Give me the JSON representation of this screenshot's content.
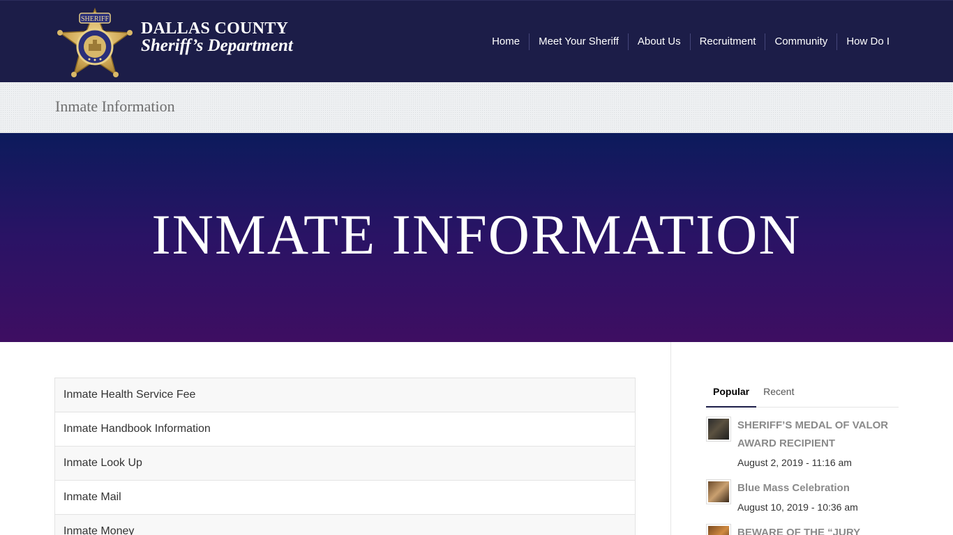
{
  "logo": {
    "line1": "DALLAS COUNTY",
    "line2": "Sheriff’s Department",
    "badge_top": "SHERIFF",
    "badge_ring": "SHERIFF'S DEPARTMENT"
  },
  "nav": [
    {
      "label": "Home"
    },
    {
      "label": "Meet Your Sheriff"
    },
    {
      "label": "About Us"
    },
    {
      "label": "Recruitment"
    },
    {
      "label": "Community"
    },
    {
      "label": "How Do I"
    }
  ],
  "breadcrumb": {
    "title": "Inmate Information"
  },
  "hero": {
    "title": "INMATE INFORMATION"
  },
  "list": [
    {
      "label": "Inmate Health Service Fee"
    },
    {
      "label": "Inmate Handbook Information"
    },
    {
      "label": "Inmate Look Up"
    },
    {
      "label": "Inmate Mail"
    },
    {
      "label": "Inmate Money"
    }
  ],
  "sidebar": {
    "tabs": [
      {
        "label": "Popular"
      },
      {
        "label": "Recent"
      }
    ],
    "posts": [
      {
        "title": "SHERIFF’S MEDAL OF VALOR AWARD RECIPIENT",
        "date": "August 2, 2019 - 11:16 am"
      },
      {
        "title": "Blue Mass Celebration",
        "date": "August 10, 2019 - 10:36 am"
      },
      {
        "title": "BEWARE OF THE “JURY",
        "date": ""
      }
    ]
  },
  "colors": {
    "header_bg": "#1c1d48",
    "hero_top": "#0c1b5c",
    "hero_bottom": "#3e0e62",
    "badge_gold": "#c9a24e"
  }
}
